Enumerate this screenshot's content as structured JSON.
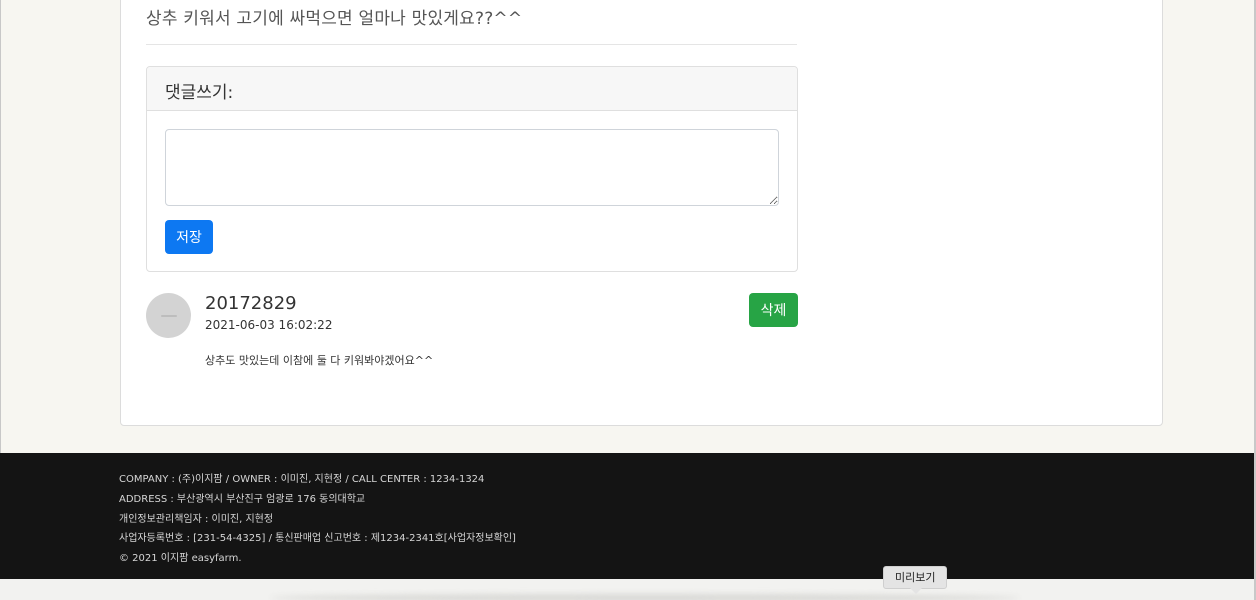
{
  "post": {
    "body_text": "상추 키워서 고기에 싸먹으면 얼마나 맛있게요??^^"
  },
  "comment_form": {
    "header": "댓글쓰기:",
    "textarea_value": "",
    "save_label": "저장"
  },
  "comments": [
    {
      "author": "20172829",
      "date": "2021-06-03 16:02:22",
      "text": "상추도 맛있는데 이참에 둘 다 키워봐야겠어요^^",
      "delete_label": "삭제"
    }
  ],
  "footer": {
    "lines": [
      "COMPANY : (주)이지팜 / OWNER : 이미진, 지현정 / CALL CENTER : 1234-1324",
      "ADDRESS : 부산광역시 부산진구 엄광로 176 동의대학교",
      "개인정보관리책임자 : 이미진, 지현정",
      "사업자등록번호 : [231-54-4325] / 통신판매업 신고번호 : 제1234-2341호[사업자정보확인]",
      "© 2021 이지팜 easyfarm."
    ]
  },
  "tooltip": {
    "label": "미리보기"
  },
  "colors": {
    "primary": "#0d78f2",
    "success": "#27a445",
    "footer_bg": "#141414",
    "page_bg": "#f7f6f1"
  }
}
